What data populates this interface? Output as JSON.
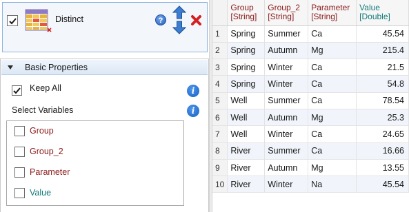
{
  "node": {
    "title": "Distinct",
    "checked": true,
    "help_icon": "question-circle-icon",
    "help_glyph": "?",
    "move_up_icon": "arrow-up-icon",
    "move_down_icon": "arrow-down-icon",
    "remove_icon": "close-icon"
  },
  "properties": {
    "section_title": "Basic Properties",
    "keep_all": {
      "label": "Keep All",
      "checked": true
    },
    "info_glyph": "i",
    "select_variables_label": "Select Variables",
    "variables": [
      {
        "name": "Group",
        "type": "String",
        "checked": false
      },
      {
        "name": "Group_2",
        "type": "String",
        "checked": false
      },
      {
        "name": "Parameter",
        "type": "String",
        "checked": false
      },
      {
        "name": "Value",
        "type": "Double",
        "checked": false
      }
    ]
  },
  "table": {
    "columns": [
      {
        "name": "Group",
        "type": "[String]"
      },
      {
        "name": "Group_2",
        "type": "[String]"
      },
      {
        "name": "Parameter",
        "type": "[String]"
      },
      {
        "name": "Value",
        "type": "[Double]"
      }
    ],
    "rows": [
      {
        "index": "1",
        "cells": [
          "Spring",
          "Summer",
          "Ca",
          "45.54"
        ]
      },
      {
        "index": "2",
        "cells": [
          "Spring",
          "Autumn",
          "Mg",
          "215.4"
        ]
      },
      {
        "index": "3",
        "cells": [
          "Spring",
          "Winter",
          "Ca",
          "21.5"
        ]
      },
      {
        "index": "4",
        "cells": [
          "Spring",
          "Winter",
          "Ca",
          "54.8"
        ]
      },
      {
        "index": "5",
        "cells": [
          "Well",
          "Summer",
          "Ca",
          "78.54"
        ]
      },
      {
        "index": "6",
        "cells": [
          "Well",
          "Autumn",
          "Mg",
          "25.3"
        ]
      },
      {
        "index": "7",
        "cells": [
          "Well",
          "Winter",
          "Ca",
          "24.65"
        ]
      },
      {
        "index": "8",
        "cells": [
          "River",
          "Summer",
          "Ca",
          "16.66"
        ]
      },
      {
        "index": "9",
        "cells": [
          "River",
          "Autumn",
          "Mg",
          "13.55"
        ]
      },
      {
        "index": "10",
        "cells": [
          "River",
          "Winter",
          "Na",
          "45.54"
        ]
      }
    ]
  },
  "colors": {
    "string_type": "#8b1a1a",
    "double_type": "#137a7a",
    "accent": "#1f5fc0",
    "remove": "#d42020"
  }
}
